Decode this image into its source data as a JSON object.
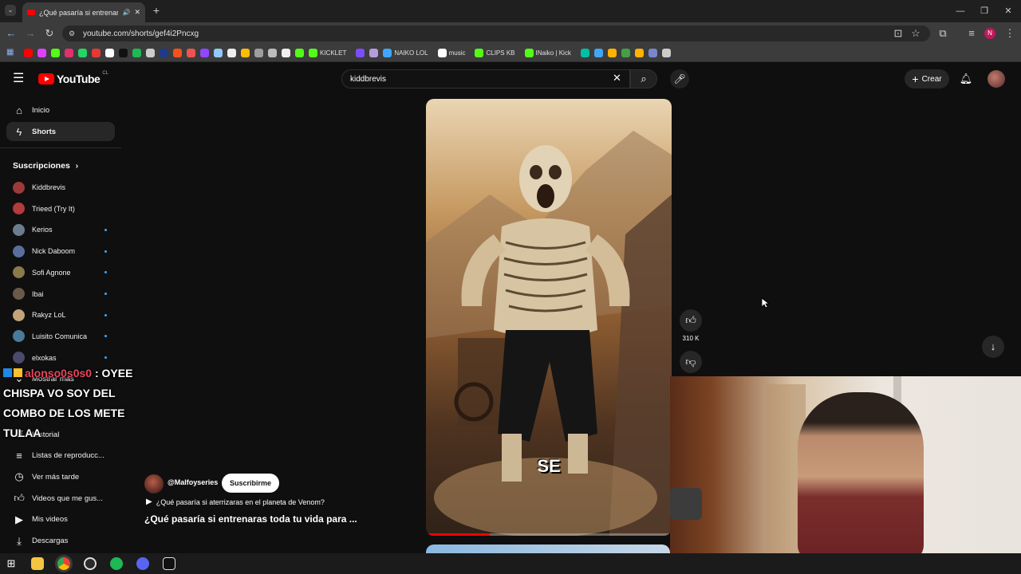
{
  "browser": {
    "tab_title": "¿Qué pasaría si entrenaras toda tu vida para ...",
    "new_tab_symbol": "+",
    "url": "youtube.com/shorts/gef4i2Pncxg",
    "bookmarks": [
      {
        "label": "",
        "color": "#ff0000"
      },
      {
        "label": "",
        "color": "#e040fb"
      },
      {
        "label": "",
        "color": "#53fc18"
      },
      {
        "label": "",
        "color": "#e1306c"
      },
      {
        "label": "",
        "color": "#25d366"
      },
      {
        "label": "",
        "color": "#e53935"
      },
      {
        "label": "",
        "color": "#ffffff"
      },
      {
        "label": "",
        "color": "#111111"
      },
      {
        "label": "",
        "color": "#1db954"
      },
      {
        "label": "",
        "color": "#cccccc"
      },
      {
        "label": "",
        "color": "#1e3a8a"
      },
      {
        "label": "",
        "color": "#f4511e"
      },
      {
        "label": "",
        "color": "#ef5350"
      },
      {
        "label": "",
        "color": "#9146ff"
      },
      {
        "label": "",
        "color": "#90caf9"
      },
      {
        "label": "",
        "color": "#eeeeee"
      },
      {
        "label": "",
        "color": "#fbbc05"
      },
      {
        "label": "",
        "color": "#9e9e9e"
      },
      {
        "label": "",
        "color": "#bdbdbd"
      },
      {
        "label": "",
        "color": "#eeeeee"
      },
      {
        "label": "",
        "color": "#53fc18"
      },
      {
        "label": "KICKLET",
        "color": "#53fc18"
      },
      {
        "label": "",
        "color": "#7c4dff"
      },
      {
        "label": "",
        "color": "#b39ddb"
      },
      {
        "label": "NAIKO LOL",
        "color": "#3ea6ff"
      },
      {
        "label": "music",
        "color": "#ffffff"
      },
      {
        "label": "CLIPS KB",
        "color": "#53fc18"
      },
      {
        "label": "INaiko | Kick",
        "color": "#53fc18"
      },
      {
        "label": "",
        "color": "#00bfa5"
      },
      {
        "label": "",
        "color": "#42a5f5"
      },
      {
        "label": "",
        "color": "#ffb300"
      },
      {
        "label": "",
        "color": "#43a047"
      },
      {
        "label": "",
        "color": "#ffb300"
      },
      {
        "label": "",
        "color": "#7986cb"
      },
      {
        "label": "",
        "color": "#cccccc"
      }
    ]
  },
  "youtube": {
    "logo_text": "YouTube",
    "country_code": "CL",
    "search_value": "kiddbrevis",
    "create_label": "Crear",
    "sidebar": {
      "main": [
        {
          "label": "Inicio",
          "icon": "home-icon"
        },
        {
          "label": "Shorts",
          "icon": "shorts-icon"
        }
      ],
      "subscriptions_title": "Suscripciones",
      "subscriptions": [
        {
          "label": "Kiddbrevis",
          "color": "#9c3a3a",
          "live": false
        },
        {
          "label": "Trieed (Try It)",
          "color": "#b23b3b",
          "live": false
        },
        {
          "label": "Kerios",
          "color": "#6b7d8c",
          "live": true
        },
        {
          "label": "Nick Daboom",
          "color": "#5a6e9c",
          "live": true
        },
        {
          "label": "Sofi Agnone",
          "color": "#8a7a4a",
          "live": true
        },
        {
          "label": "Ibai",
          "color": "#6a5a4a",
          "live": true
        },
        {
          "label": "Rakyz LoL",
          "color": "#c4a37a",
          "live": true
        },
        {
          "label": "Luisito Comunica",
          "color": "#4a7a9a",
          "live": true
        },
        {
          "label": "elxokas",
          "color": "#4a4a6a",
          "live": true
        }
      ],
      "show_more": "Mostrar más",
      "you_items": [
        {
          "label": "Historial",
          "icon": "history-icon"
        },
        {
          "label": "Listas de reproducc...",
          "icon": "playlist-icon"
        },
        {
          "label": "Ver más tarde",
          "icon": "watch-later-icon"
        },
        {
          "label": "Videos que me gus...",
          "icon": "liked-icon"
        },
        {
          "label": "Mis videos",
          "icon": "my-videos-icon"
        },
        {
          "label": "Descargas",
          "icon": "downloads-icon"
        }
      ]
    },
    "short": {
      "caption": "SE",
      "progress": 0.26,
      "like_count": "310 K",
      "channel": "@Malfoyseries",
      "subscribe_label": "Suscribirme",
      "related": "¿Qué pasaría si aterrizaras en el planeta de Venom?",
      "title": "¿Qué pasaría si entrenaras toda tu vida para ..."
    }
  },
  "stream_chat": {
    "user": "alonso0s0s0",
    "separator": ":",
    "message_line1": "OYEE",
    "message_line2": "CHISPA VO SOY DEL",
    "message_line3": "COMBO DE LOS METE",
    "message_line4": "TULAA"
  },
  "taskbar": {
    "apps": [
      "windows-start",
      "file-explorer",
      "chrome",
      "obs",
      "spotify",
      "discord",
      "capcut"
    ]
  }
}
